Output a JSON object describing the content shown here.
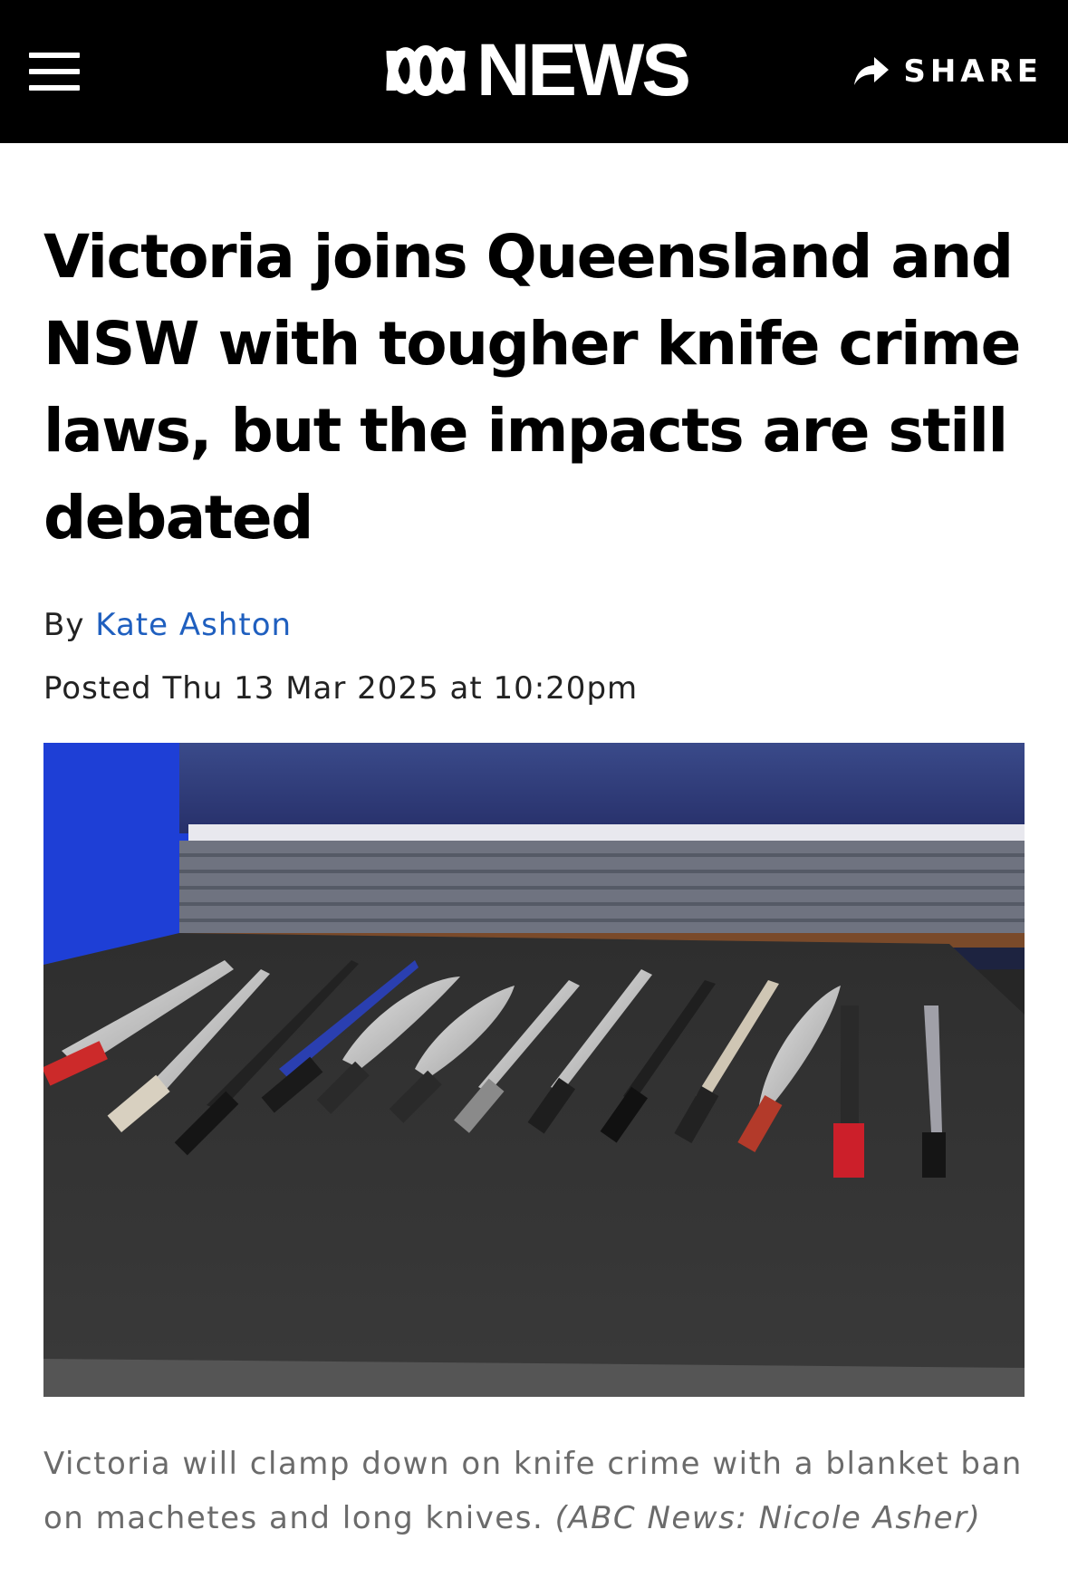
{
  "header": {
    "menu_icon": "hamburger-menu-icon",
    "logo_text": "NEWS",
    "logo_icon": "abc-lissajous-logo-icon",
    "share_label": "SHARE",
    "share_icon": "share-arrow-icon"
  },
  "article": {
    "headline": "Victoria joins Queensland and NSW with tougher knife crime laws, but the impacts are still debated",
    "byline_prefix": "By",
    "author": "Kate Ashton",
    "posted": "Posted Thu 13 Mar 2025 at 10:20pm",
    "image_alt": "A row of machetes and long knives laid out on a black cloth-covered table",
    "caption_text": "Victoria will clamp down on knife crime with a blanket ban on machetes and long knives.",
    "caption_credit": "(ABC News: Nicole Asher)"
  },
  "colors": {
    "topbar": "#000000",
    "author_link": "#1f5fbf",
    "caption": "#6b6b6b"
  }
}
